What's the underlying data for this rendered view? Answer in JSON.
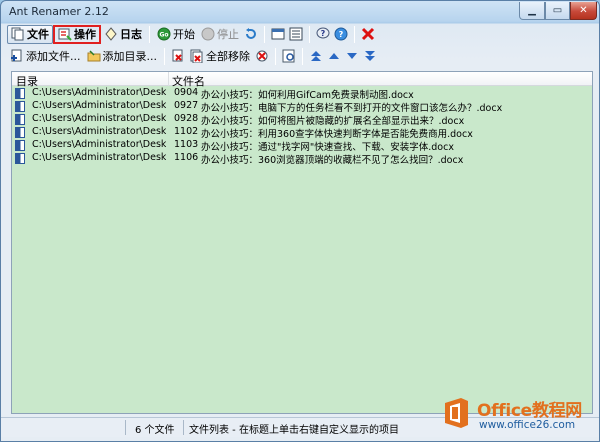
{
  "window": {
    "title": "Ant Renamer 2.12"
  },
  "toolbar1": {
    "file_tab": "文件",
    "action_tab": "操作",
    "log_tab": "日志",
    "start_label": "开始",
    "stop_label": "停止"
  },
  "toolbar2": {
    "add_files": "添加文件...",
    "add_folder": "添加目录...",
    "remove_all": "全部移除"
  },
  "list": {
    "columns": [
      "目录",
      "文件名"
    ],
    "rows": [
      {
        "dir": "C:\\Users\\Administrator\\Desktop\\...",
        "num": "0904",
        "name": "办公小技巧：如何利用GifCam免费录制动图.docx"
      },
      {
        "dir": "C:\\Users\\Administrator\\Desktop\\...",
        "num": "0927",
        "name": "办公小技巧：电脑下方的任务栏看不到打开的文件窗口该怎么办？.docx"
      },
      {
        "dir": "C:\\Users\\Administrator\\Desktop\\...",
        "num": "0928",
        "name": "办公小技巧：如何将图片被隐藏的扩展名全部显示出来？.docx"
      },
      {
        "dir": "C:\\Users\\Administrator\\Desktop\\...",
        "num": "1102",
        "name": "办公小技巧：利用360查字体快速判断字体是否能免费商用.docx"
      },
      {
        "dir": "C:\\Users\\Administrator\\Desktop\\...",
        "num": "1103",
        "name": "办公小技巧：通过\"找字网\"快速查找、下载、安装字体.docx"
      },
      {
        "dir": "C:\\Users\\Administrator\\Desktop\\...",
        "num": "1106",
        "name": "办公小技巧：360浏览器顶端的收藏栏不见了怎么找回？.docx"
      }
    ]
  },
  "status": {
    "count": "6 个文件",
    "message": "文件列表 - 在标题上单击右键自定义显示的项目"
  },
  "watermark": {
    "brand": "Office教程网",
    "url": "www.office26.com"
  },
  "colors": {
    "list_bg": "#c9e8cb",
    "highlight_border": "#e02020",
    "watermark_orange": "#e2701e"
  }
}
